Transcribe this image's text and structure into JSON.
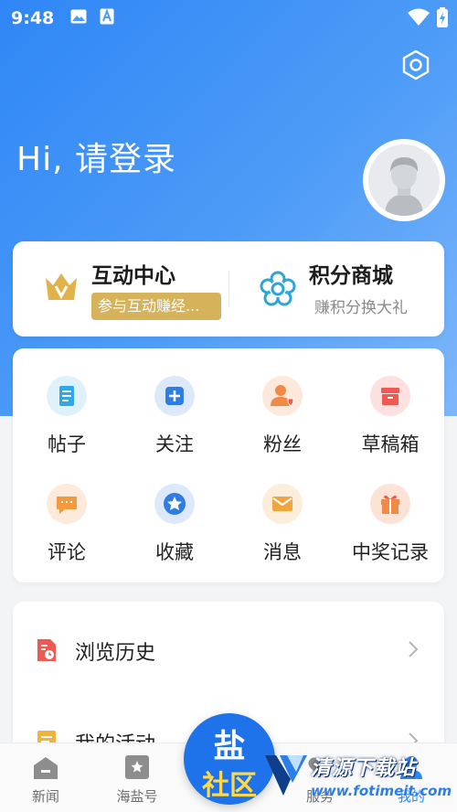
{
  "status_bar": {
    "time": "9:48"
  },
  "header": {
    "greeting": "Hi, 请登录"
  },
  "top_card": {
    "interaction": {
      "title": "互动中心",
      "badge": "参与互动赚经..."
    },
    "points_mall": {
      "title": "积分商城",
      "subtitle": "赚积分换大礼"
    }
  },
  "grid": [
    {
      "label": "帖子",
      "icon": "posts-icon",
      "color": "#2ea8e8"
    },
    {
      "label": "关注",
      "icon": "follow-icon",
      "color": "#2f7de1"
    },
    {
      "label": "粉丝",
      "icon": "fans-icon",
      "color": "#f08a45"
    },
    {
      "label": "草稿箱",
      "icon": "drafts-icon",
      "color": "#ee5a52"
    },
    {
      "label": "评论",
      "icon": "comment-icon",
      "color": "#f39a3e"
    },
    {
      "label": "收藏",
      "icon": "favorite-icon",
      "color": "#2f7de1"
    },
    {
      "label": "消息",
      "icon": "message-icon",
      "color": "#f0a63e"
    },
    {
      "label": "中奖记录",
      "icon": "prize-icon",
      "color": "#f08a45"
    }
  ],
  "list": [
    {
      "label": "浏览历史",
      "icon": "history-icon"
    },
    {
      "label": "我的活动",
      "icon": "activity-icon"
    }
  ],
  "tabbar": {
    "tabs": [
      {
        "label": "新闻",
        "icon": "news-icon"
      },
      {
        "label": "海盐号",
        "icon": "haiyan-icon"
      },
      {
        "label": "服务",
        "icon": "service-icon"
      },
      {
        "label": "我的",
        "icon": "mine-icon"
      }
    ],
    "center": {
      "line1": "盐",
      "line2": "社区"
    }
  },
  "watermark": {
    "text": "清源下载站",
    "url": "www.fotimeit.com"
  },
  "colors": {
    "accent": "#2f86f5",
    "gold": "#d6b25a"
  }
}
